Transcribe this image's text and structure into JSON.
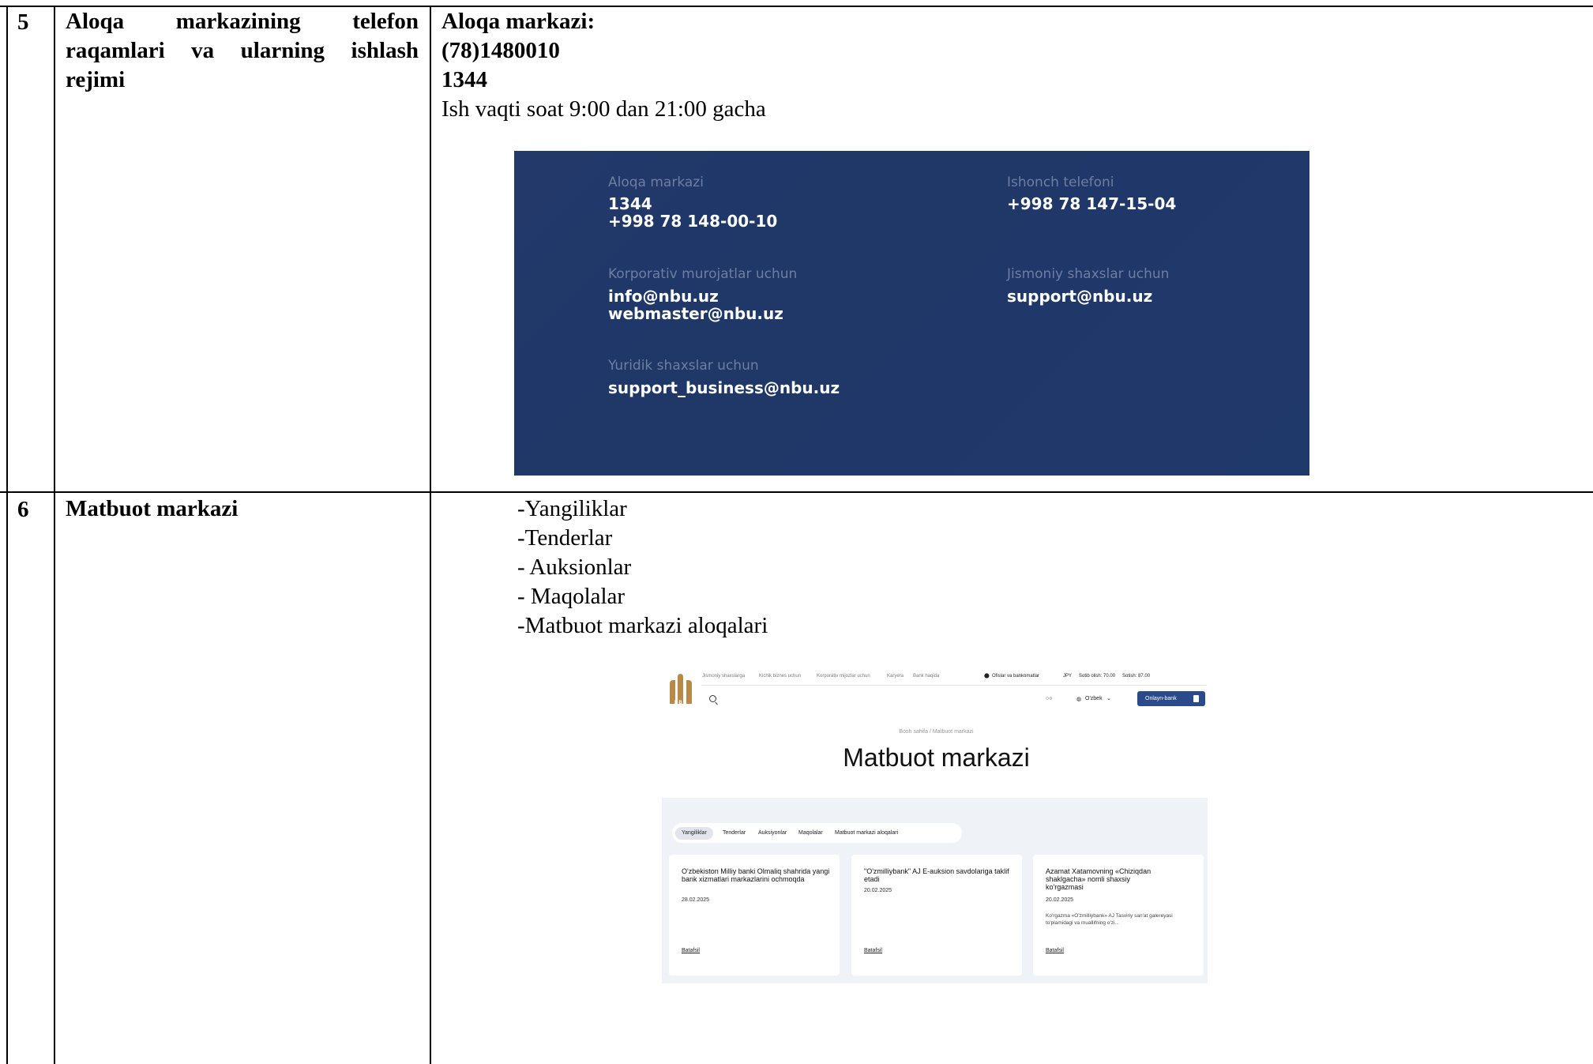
{
  "rows": [
    {
      "number": "5",
      "title": "Aloqa markazining telefon raqamlari va ularning ishlash rejimi",
      "info": {
        "heading": "Aloqa markazi:",
        "phone1": "(78)1480010",
        "phone2": "1344",
        "hours": "Ish vaqti soat 9:00 dan 21:00 gacha"
      },
      "contact_panel": {
        "contact_center_label": "Aloqa markazi",
        "contact_center_value": "1344\n+998 78 148-00-10",
        "trust_phone_label": "Ishonch telefoni",
        "trust_phone_value": "+998 78 147-15-04",
        "corporate_label": "Korporativ murojatlar uchun",
        "corporate_value": "info@nbu.uz\nwebmaster@nbu.uz",
        "individuals_label": "Jismoniy shaxslar uchun",
        "individuals_value": "support@nbu.uz",
        "legal_label": "Yuridik shaxslar uchun",
        "legal_value": "support_business@nbu.uz"
      }
    },
    {
      "number": "6",
      "title": "Matbuot markazi",
      "list": [
        "-Yangiliklar",
        "-Tenderlar",
        "- Auksionlar",
        "- Maqolalar",
        "-Matbuot markazi aloqalari"
      ],
      "site": {
        "logo_text": "NBU",
        "nav": [
          "Jismoniy shaxslarga",
          "Kichik biznes uchun",
          "Korporativ mijozlar uchun",
          "Karyera",
          "Bank haqida"
        ],
        "offices": "Ofislar va bankomatlar",
        "currency": "JPY",
        "buy": "Sotib olish: 70.00",
        "sell": "Sotish: 87.00",
        "language": "O'zbek",
        "online_bank": "Onlayn-bank",
        "breadcrumb": "Bosh sahifa  /  Matbuot markazi",
        "heading": "Matbuot markazi",
        "tabs": [
          "Yangiliklar",
          "Tenderlar",
          "Auksiyonlar",
          "Maqolalar",
          "Matbuot markazi aloqalari"
        ],
        "cards": [
          {
            "title": "O'zbekiston Milliy banki Olmaliq shahrida yangi bank xizmatlari markazlarini ochmoqda",
            "date": "28.02.2025",
            "desc": "",
            "link": "Batafsil"
          },
          {
            "title": "\"O'zmilliybank\" AJ E-auksion savdolariga taklif etadi",
            "date": "20.02.2025",
            "desc": "",
            "link": "Batafsil"
          },
          {
            "title": "Azamat Xatamovning «Chiziqdan shaklgacha» nomli shaxsiy ko'rgazmasi",
            "date": "20.02.2025",
            "desc": "Ko'rgazma «O'zmilliybank» AJ Tasviriy san'at galereyasi to'plamidagi va muallifning o'zi...",
            "link": "Batafsil"
          }
        ]
      }
    }
  ]
}
